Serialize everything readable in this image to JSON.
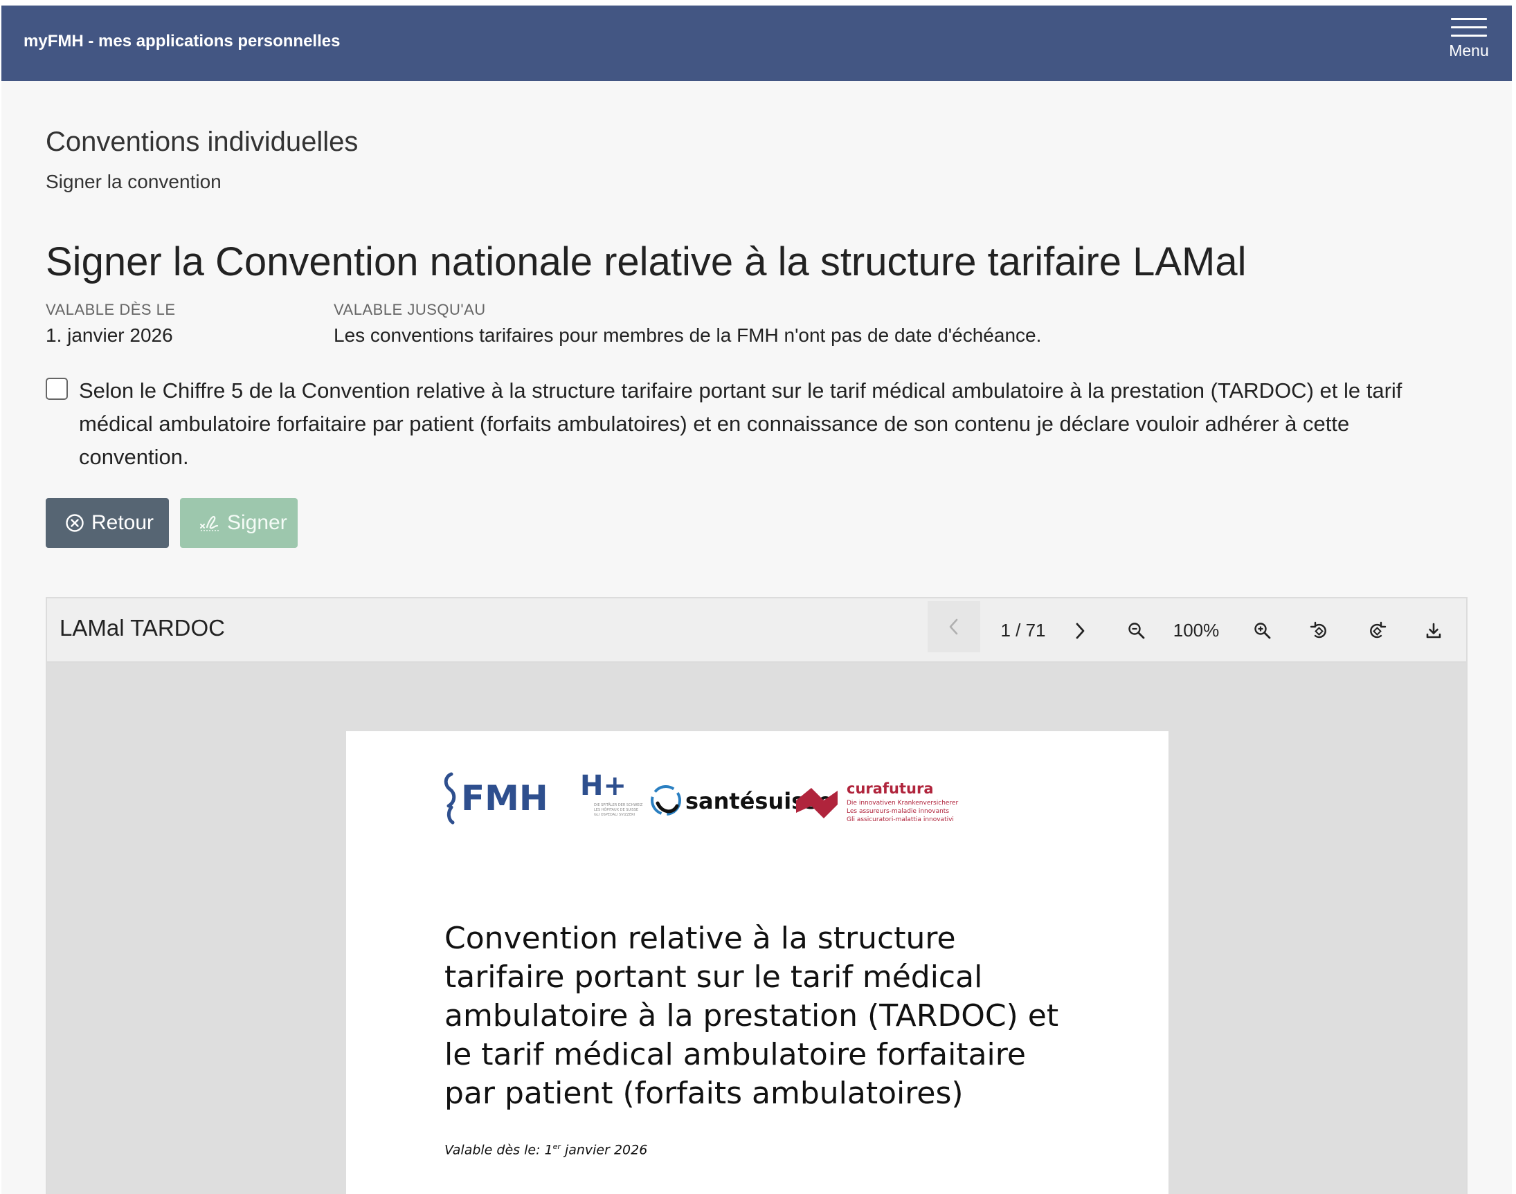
{
  "header": {
    "app_title": "myFMH - mes applications personnelles",
    "menu_label": "Menu"
  },
  "page": {
    "section_title": "Conventions individuelles",
    "section_subtitle": "Signer la convention",
    "main_title": "Signer la Convention nationale relative à la structure tarifaire LAMal",
    "valid_from_label": "VALABLE DÈS LE",
    "valid_from_value": "1. janvier 2026",
    "valid_until_label": "VALABLE JUSQU'AU",
    "valid_until_value": "Les conventions tarifaires pour membres de la FMH n'ont pas de date d'échéance.",
    "consent_text": "Selon le Chiffre 5 de la Convention relative à la structure tarifaire portant sur le tarif médical ambulatoire à la prestation (TARDOC) et le tarif médical ambulatoire forfaitaire par patient (forfaits ambulatoires) et en connaissance de son contenu je déclare vouloir adhérer à cette convention.",
    "consent_checked": false,
    "retour_label": "Retour",
    "signer_label": "Signer"
  },
  "viewer": {
    "title": "LAMal TARDOC",
    "page_indicator": "1 / 71",
    "zoom": "100%",
    "icons": [
      "chevron-left-icon",
      "chevron-right-icon",
      "zoom-out-icon",
      "zoom-in-icon",
      "rotate-left-icon",
      "rotate-right-icon",
      "download-icon"
    ]
  },
  "document": {
    "logos": {
      "fmh": "FMH",
      "hplus": "H+",
      "hplus_sub": [
        "DIE SPITÄLER DER SCHWEIZ",
        "LES HÔPITAUX DE SUISSE",
        "GLI OSPEDALI SVIZZERI"
      ],
      "santesuisse": "santésuisse",
      "curafutura": "curafutura",
      "curafutura_sub": [
        "Die innovativen Krankenversicherer",
        "Les assureurs-maladie innovants",
        "Gli assicuratori-malattia innovativi"
      ]
    },
    "title": "Convention relative à la structure tarifaire portant sur le tarif médical ambulatoire à la prestation (TARDOC) et le tarif médical ambulatoire forfaitaire par patient (forfaits ambulatoires)",
    "date_prefix": "Valable dès le: 1",
    "date_sup": "er",
    "date_suffix": " janvier 2026"
  },
  "colors": {
    "header_bg": "#435683",
    "retour_bg": "#566573",
    "signer_bg": "#9dc7ad",
    "fmh_blue": "#2e4f8e",
    "curafutura_red": "#b0243c"
  }
}
